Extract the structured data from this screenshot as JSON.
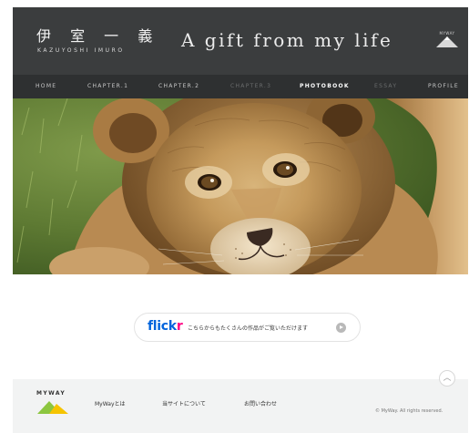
{
  "header": {
    "logo_jp": "伊 室 一 義",
    "logo_en": "KAZUYOSHI IMURO",
    "title": "A gift from my life",
    "brand_small": "MYWAY"
  },
  "nav": {
    "items": [
      {
        "label": "HOME",
        "state": "normal"
      },
      {
        "label": "CHAPTER.1",
        "state": "normal"
      },
      {
        "label": "CHAPTER.2",
        "state": "normal"
      },
      {
        "label": "CHAPTER.3",
        "state": "disabled"
      },
      {
        "label": "PHOTOBOOK",
        "state": "active"
      },
      {
        "label": "ESSAY",
        "state": "disabled"
      },
      {
        "label": "PROFILE",
        "state": "normal"
      }
    ]
  },
  "hero": {
    "icon": "lion-cub-photo"
  },
  "flickr": {
    "logo_part1": "flick",
    "logo_part2": "r",
    "text": "こちらからもたくさんの作品がご覧いただけます",
    "icon": "arrow-right-circle-icon"
  },
  "footer": {
    "brand": "MYWAY",
    "links": [
      "MyWayとは",
      "当サイトについて",
      "お問い合わせ"
    ],
    "copyright": "© MyWay. All rights reserved.",
    "scroll_top_glyph": "︿"
  },
  "colors": {
    "header_bg": "#3b3d3e",
    "nav_bg": "#2e3031",
    "footer_bg": "#f2f3f3",
    "flickr_blue": "#0063dc",
    "flickr_pink": "#ff0084",
    "logo_green": "#8cc63f",
    "logo_yellow": "#f5c400"
  }
}
